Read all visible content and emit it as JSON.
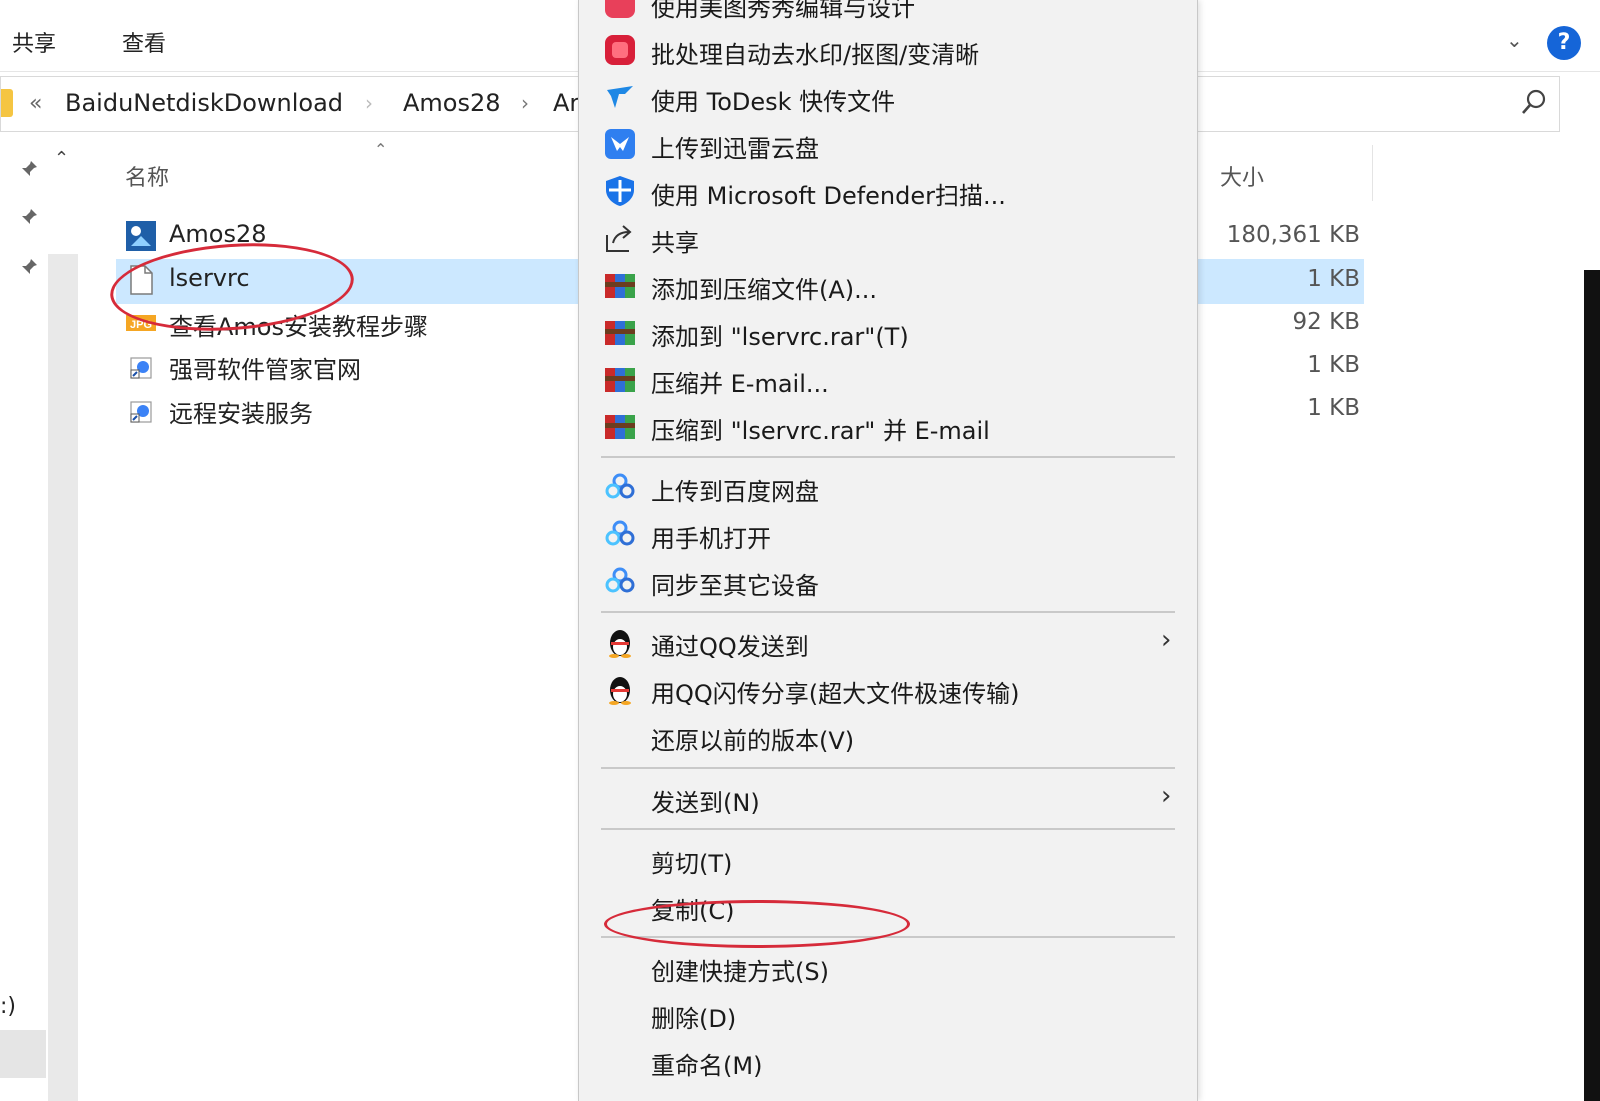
{
  "ribbon": {
    "tabs": [
      "共享",
      "查看"
    ]
  },
  "address": {
    "overflow": "«",
    "crumbs": [
      "BaiduNetdiskDownload",
      "Amos28",
      "Ar"
    ]
  },
  "columns": {
    "name": "名称",
    "size": "大小"
  },
  "files": [
    {
      "name": "Amos28",
      "size": "180,361 KB",
      "icon": "amos-app-icon"
    },
    {
      "name": "lservrc",
      "size": "1 KB",
      "icon": "blank-file-icon",
      "selected": true
    },
    {
      "name": "查看Amos安装教程步骤",
      "size": "92 KB",
      "icon": "jpg-image-icon"
    },
    {
      "name": "强哥软件管家官网",
      "size": "1 KB",
      "icon": "internet-shortcut-icon"
    },
    {
      "name": "远程安装服务",
      "size": "1 KB",
      "icon": "internet-shortcut-icon"
    }
  ],
  "nav": {
    "drive_label": ":)"
  },
  "context_menu": {
    "top_partial": "使用美图秀秀编辑与设计",
    "items": [
      {
        "label": "批处理自动去水印/抠图/变清晰",
        "icon": "meitu-batch-icon"
      },
      {
        "label": "使用 ToDesk 快传文件",
        "icon": "todesk-icon"
      },
      {
        "label": "上传到迅雷云盘",
        "icon": "xunlei-icon"
      },
      {
        "label": "使用 Microsoft Defender扫描...",
        "icon": "defender-shield-icon"
      },
      {
        "label": "共享",
        "icon": "share-icon"
      },
      {
        "label": "添加到压缩文件(A)...",
        "icon": "winrar-icon"
      },
      {
        "label": "添加到 \"lservrc.rar\"(T)",
        "icon": "winrar-icon"
      },
      {
        "label": "压缩并 E-mail...",
        "icon": "winrar-icon"
      },
      {
        "label": "压缩到 \"lservrc.rar\" 并 E-mail",
        "icon": "winrar-icon"
      },
      {
        "label": "上传到百度网盘",
        "icon": "baidu-netdisk-icon"
      },
      {
        "label": "用手机打开",
        "icon": "baidu-netdisk-icon"
      },
      {
        "label": "同步至其它设备",
        "icon": "baidu-netdisk-icon"
      },
      {
        "label": "通过QQ发送到",
        "icon": "qq-penguin-icon"
      },
      {
        "label": "用QQ闪传分享(超大文件极速传输)",
        "icon": "qq-penguin-icon"
      },
      {
        "label": "还原以前的版本(V)",
        "icon": ""
      },
      {
        "label": "发送到(N)",
        "icon": ""
      },
      {
        "label": "剪切(T)",
        "icon": ""
      },
      {
        "label": "复制(C)",
        "icon": ""
      },
      {
        "label": "创建快捷方式(S)",
        "icon": ""
      },
      {
        "label": "删除(D)",
        "icon": ""
      },
      {
        "label": "重命名(M)",
        "icon": ""
      }
    ]
  },
  "colors": {
    "selection": "#cce8ff",
    "annotation": "#d62b3a",
    "menu_bg": "#f2f2f2",
    "help": "#1565d8"
  }
}
